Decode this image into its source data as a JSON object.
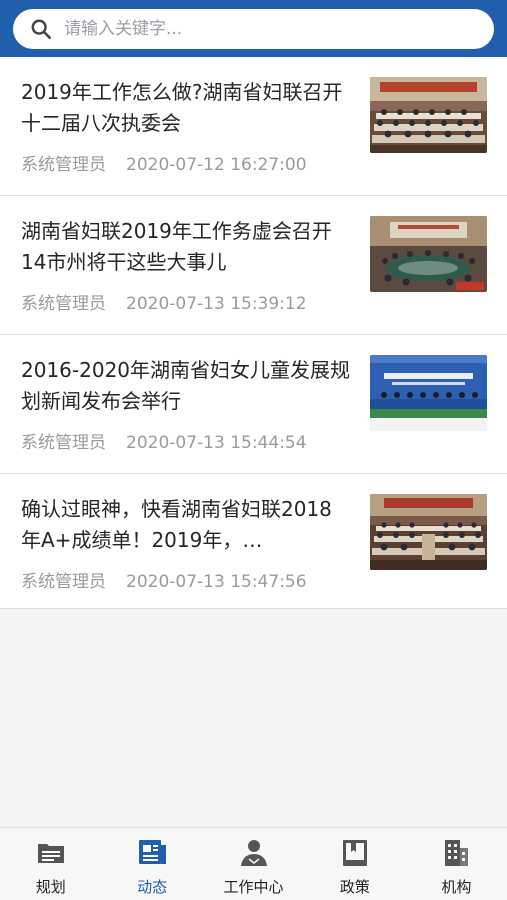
{
  "search": {
    "placeholder": "请输入关键字..."
  },
  "news": [
    {
      "title": "2019年工作怎么做?湖南省妇联召开十二届八次执委会",
      "author": "系统管理员",
      "date": "2020-07-12 16:27:00"
    },
    {
      "title": "湖南省妇联2019年工作务虚会召开 14市州将干这些大事儿",
      "author": "系统管理员",
      "date": "2020-07-13 15:39:12"
    },
    {
      "title": "2016-2020年湖南省妇女儿童发展规划新闻发布会举行",
      "author": "系统管理员",
      "date": "2020-07-13 15:44:54"
    },
    {
      "title": "确认过眼神，快看湖南省妇联2018年A+成绩单！2019年，…",
      "author": "系统管理员",
      "date": "2020-07-13 15:47:56"
    }
  ],
  "tabs": [
    {
      "label": "规划",
      "icon": "folder-list-icon"
    },
    {
      "label": "动态",
      "icon": "news-document-icon"
    },
    {
      "label": "工作中心",
      "icon": "user-icon"
    },
    {
      "label": "政策",
      "icon": "book-icon"
    },
    {
      "label": "机构",
      "icon": "building-icon"
    }
  ],
  "colors": {
    "brand": "#1f5fae",
    "tab_inactive": "#555555",
    "meta_text": "#9b9b9b"
  },
  "active_tab": "动态"
}
